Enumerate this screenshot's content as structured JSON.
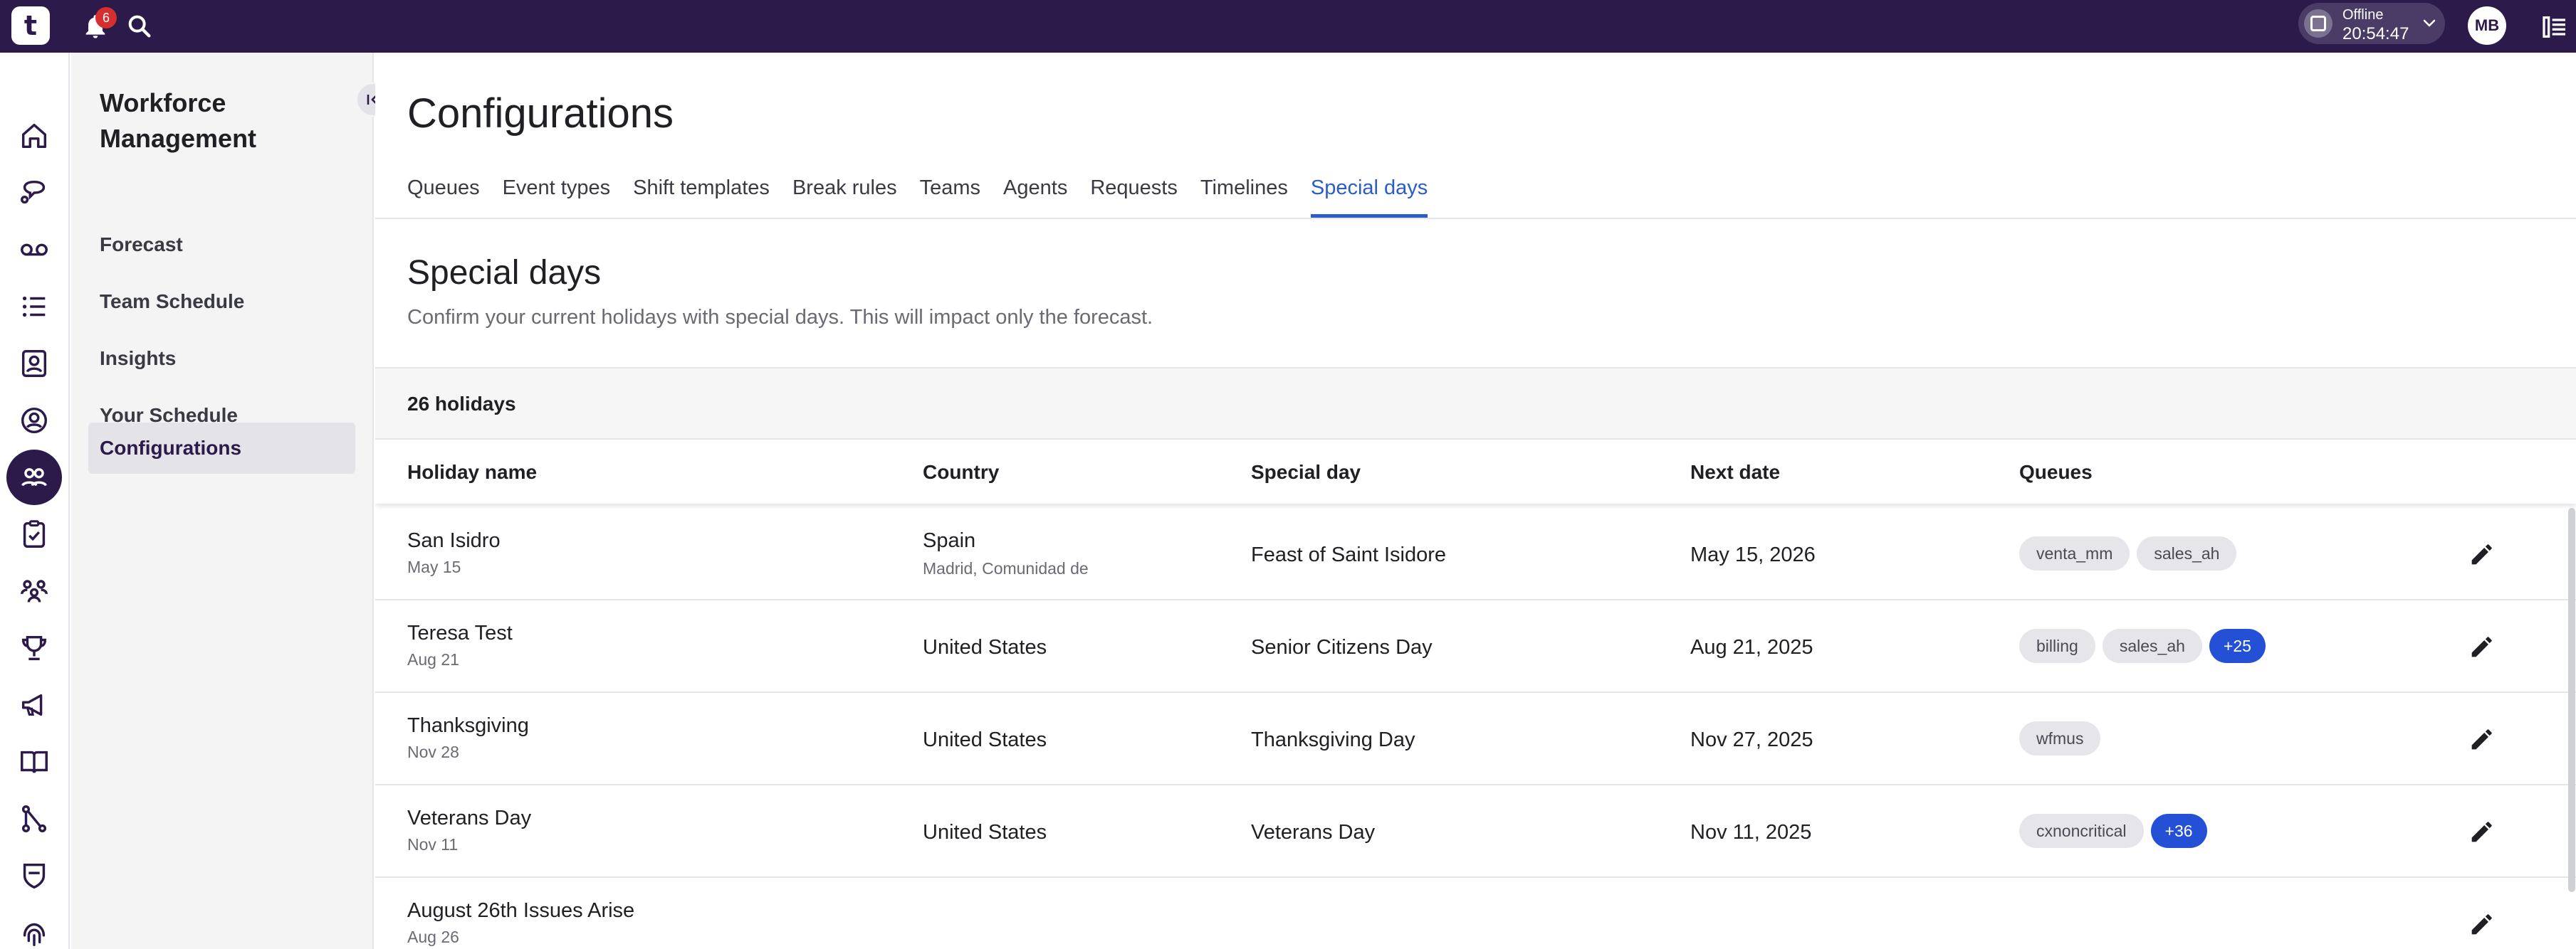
{
  "topbar": {
    "logo_text": "t",
    "notification_count": "6",
    "status_label": "Offline",
    "status_time": "20:54:47",
    "avatar_initials": "MB",
    "icons": [
      "bell-icon",
      "search-icon",
      "chevron-down-icon",
      "panel-toggle-icon"
    ]
  },
  "rail": {
    "icons": [
      "home-icon",
      "chat-icon",
      "voicemail-icon",
      "list-icon",
      "contacts-icon",
      "agent-icon",
      "workforce-icon",
      "task-icon",
      "team-icon",
      "trophy-icon",
      "megaphone-icon",
      "book-icon",
      "flow-icon",
      "shield-icon",
      "fingerprint-icon"
    ],
    "active_index": 6
  },
  "sidenav": {
    "title": "Workforce Management",
    "items": [
      {
        "label": "Forecast"
      },
      {
        "label": "Team Schedule"
      },
      {
        "label": "Insights"
      },
      {
        "label": "Your Schedule"
      },
      {
        "label": "Configurations"
      }
    ],
    "active_index": 4
  },
  "main": {
    "title": "Configurations",
    "tabs": [
      {
        "label": "Queues"
      },
      {
        "label": "Event types"
      },
      {
        "label": "Shift templates"
      },
      {
        "label": "Break rules"
      },
      {
        "label": "Teams"
      },
      {
        "label": "Agents"
      },
      {
        "label": "Requests"
      },
      {
        "label": "Timelines"
      },
      {
        "label": "Special days"
      }
    ],
    "active_tab_index": 8,
    "section_title": "Special days",
    "section_description": "Confirm your current holidays with special days. This will impact only the forecast.",
    "count_label": "26 holidays"
  },
  "table": {
    "columns": [
      "Holiday name",
      "Country",
      "Special day",
      "Next date",
      "Queues"
    ],
    "rows": [
      {
        "name": "San Isidro",
        "date": "May 15",
        "country": "Spain",
        "region": "Madrid, Comunidad de",
        "special_day": "Feast of Saint Isidore",
        "next_date": "May 15, 2026",
        "queues": [
          "venta_mm",
          "sales_ah"
        ],
        "more": ""
      },
      {
        "name": "Teresa Test",
        "date": "Aug 21",
        "country": "United States",
        "region": "",
        "special_day": "Senior Citizens Day",
        "next_date": "Aug 21, 2025",
        "queues": [
          "billing",
          "sales_ah"
        ],
        "more": "+25"
      },
      {
        "name": "Thanksgiving",
        "date": "Nov 28",
        "country": "United States",
        "region": "",
        "special_day": "Thanksgiving Day",
        "next_date": "Nov 27, 2025",
        "queues": [
          "wfmus"
        ],
        "more": ""
      },
      {
        "name": "Veterans Day",
        "date": "Nov 11",
        "country": "United States",
        "region": "",
        "special_day": "Veterans Day",
        "next_date": "Nov 11, 2025",
        "queues": [
          "cxnoncritical"
        ],
        "more": "+36"
      },
      {
        "name": "August 26th Issues Arise",
        "date": "Aug 26",
        "country": "",
        "region": "",
        "special_day": "",
        "next_date": "",
        "queues": [],
        "more": ""
      }
    ]
  },
  "colors": {
    "topbar_bg": "#2b1a4a",
    "accent": "#2b5cc9",
    "chip_more": "#2450d6",
    "badge": "#d62f2f"
  }
}
